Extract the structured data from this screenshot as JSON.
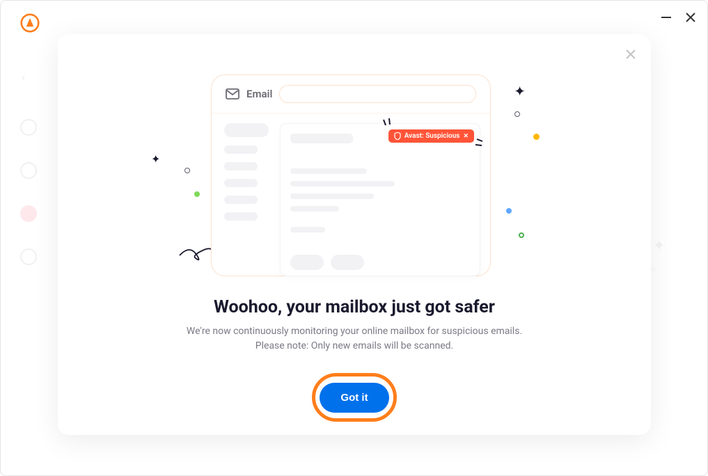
{
  "illustration": {
    "email_label": "Email",
    "badge_text": "Avast: Suspicious"
  },
  "heading": "Woohoo, your mailbox just got safer",
  "subtext_line1": "We're now continuously monitoring your online mailbox for suspicious emails.",
  "subtext_line2": "Please note: Only new emails will be scanned.",
  "cta_label": "Got it",
  "colors": {
    "primary": "#0071eb",
    "accent": "#ff7e1b",
    "danger": "#ff5438"
  }
}
